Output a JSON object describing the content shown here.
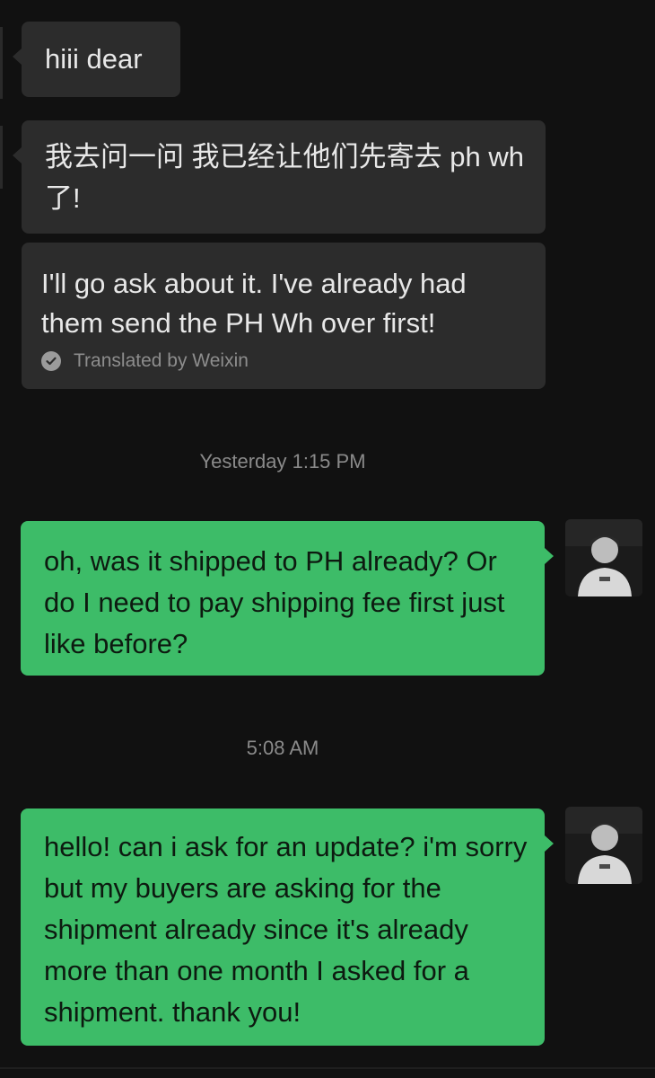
{
  "colors": {
    "background": "#111111",
    "incoming_bubble": "#2c2c2c",
    "outgoing_bubble": "#3dbc68",
    "timestamp_text": "#8a8a8a"
  },
  "messages": {
    "m1": {
      "text": "hiii dear"
    },
    "m2": {
      "text": "我去问一问 我已经让他们先寄去 ph wh 了!",
      "translation": "I'll go ask about it. I've already had them send the PH Wh over first!",
      "translated_by": "Translated by Weixin"
    },
    "ts1": "Yesterday 1:15 PM",
    "m3": {
      "text": "oh, was it shipped to PH already? Or do I need to pay shipping fee first just like before?"
    },
    "ts2": "5:08 AM",
    "m4": {
      "text": "hello! can i ask for an update? i'm sorry but my buyers are asking for the shipment already since it's already more than one month I asked for a shipment. thank you!"
    }
  },
  "icons": {
    "translated": "check-circle-icon",
    "avatar": "user-avatar-photo"
  }
}
